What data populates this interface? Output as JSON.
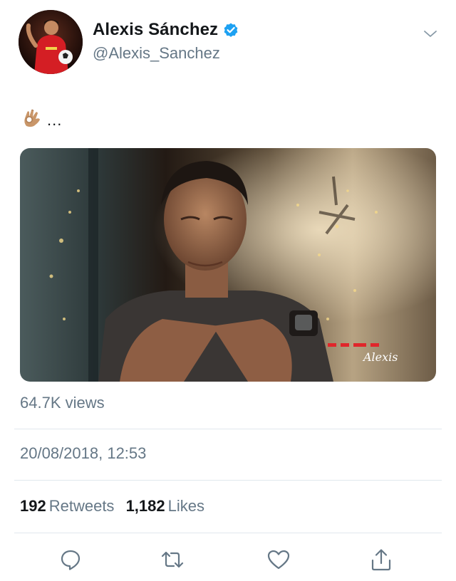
{
  "user": {
    "display_name": "Alexis Sánchez",
    "handle": "@Alexis_Sanchez",
    "verified": true
  },
  "tweet": {
    "emoji": "ok-hand-emoji",
    "text": "...",
    "media_watermark": "Alexis",
    "views": "64.7K views",
    "timestamp": "20/08/2018, 12:53"
  },
  "stats": {
    "retweets_count": "192",
    "retweets_label": "Retweets",
    "likes_count": "1,182",
    "likes_label": "Likes"
  },
  "actions": [
    "reply-icon",
    "retweet-icon",
    "like-icon",
    "share-icon"
  ],
  "colors": {
    "primary_text": "#14171a",
    "secondary_text": "#657786",
    "verified_blue": "#1da1f2",
    "divider": "#e1e8ed",
    "action_icon": "#657786",
    "watermark_red": "#e0262b"
  }
}
